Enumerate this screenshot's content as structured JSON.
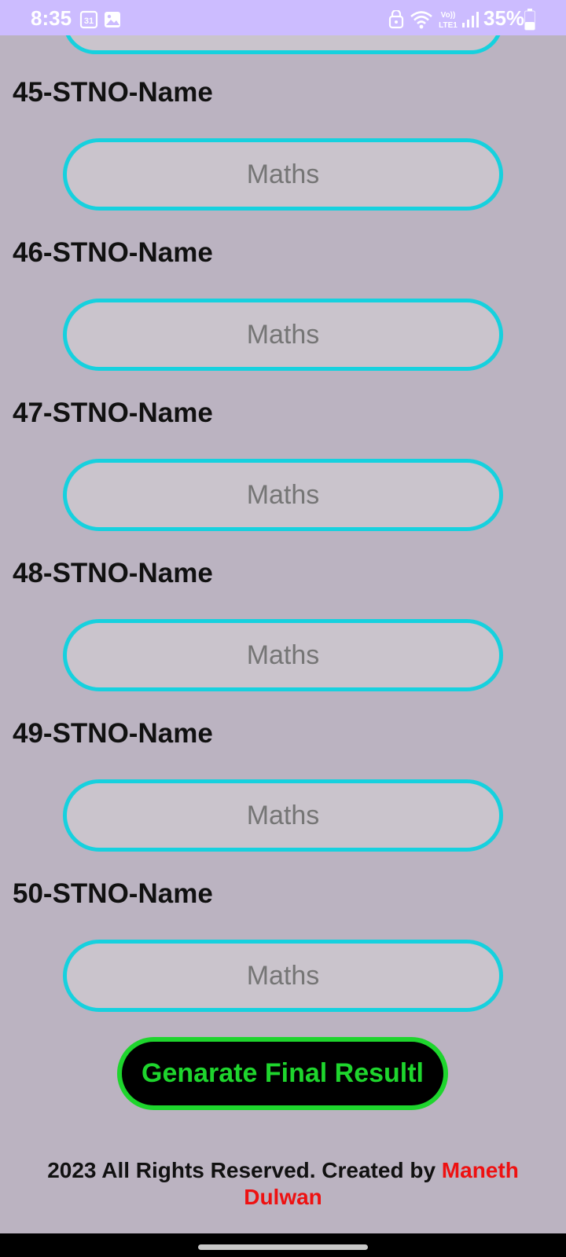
{
  "status_bar": {
    "time": "8:35",
    "calendar_day": "31",
    "battery_percent": "35%",
    "network_label_top": "Vo))",
    "network_label_bottom": "LTE1",
    "background_color": "#ccbcff"
  },
  "students": [
    {
      "label": "45-STNO-Name",
      "placeholder": "Maths"
    },
    {
      "label": "46-STNO-Name",
      "placeholder": "Maths"
    },
    {
      "label": "47-STNO-Name",
      "placeholder": "Maths"
    },
    {
      "label": "48-STNO-Name",
      "placeholder": "Maths"
    },
    {
      "label": "49-STNO-Name",
      "placeholder": "Maths"
    },
    {
      "label": "50-STNO-Name",
      "placeholder": "Maths"
    }
  ],
  "generate_button": {
    "label": "Genarate Final Resultl"
  },
  "footer": {
    "text": "2023 All Rights Reserved. Created by ",
    "author": "Maneth Dulwan"
  },
  "colors": {
    "background": "#bbb3c1",
    "field_border": "#16d1de",
    "field_fill": "#cac4cc",
    "button_accent": "#1ed52d",
    "author_red": "#ee1111"
  }
}
